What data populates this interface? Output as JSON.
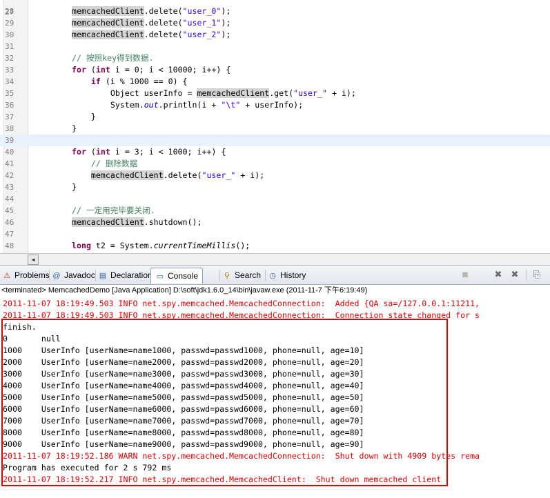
{
  "editor": {
    "lines": [
      {
        "num": "28",
        "text": "memcachedClient.delete(\"user_0\");"
      },
      {
        "num": "29",
        "text": "memcachedClient.delete(\"user_1\");"
      },
      {
        "num": "30",
        "text": "memcachedClient.delete(\"user_2\");"
      },
      {
        "num": "31",
        "text": ""
      },
      {
        "num": "32",
        "text": "// 按照key得到数据."
      },
      {
        "num": "33",
        "text": "for (int i = 0; i < 10000; i++) {"
      },
      {
        "num": "34",
        "text": "    if (i % 1000 == 0) {"
      },
      {
        "num": "35",
        "text": "        Object userInfo = memcachedClient.get(\"user_\" + i);"
      },
      {
        "num": "36",
        "text": "        System.out.println(i + \"\\t\" + userInfo);"
      },
      {
        "num": "37",
        "text": "    }"
      },
      {
        "num": "38",
        "text": "}"
      },
      {
        "num": "39",
        "text": ""
      },
      {
        "num": "40",
        "text": "for (int i = 3; i < 1000; i++) {"
      },
      {
        "num": "41",
        "text": "    // 删除数据"
      },
      {
        "num": "42",
        "text": "    memcachedClient.delete(\"user_\" + i);"
      },
      {
        "num": "43",
        "text": "}"
      },
      {
        "num": "44",
        "text": ""
      },
      {
        "num": "45",
        "text": "// 一定用完毕要关闭."
      },
      {
        "num": "46",
        "text": "memcachedClient.shutdown();"
      },
      {
        "num": "47",
        "text": ""
      },
      {
        "num": "48",
        "text": "long t2 = System.currentTimeMillis();"
      }
    ]
  },
  "tabs": [
    {
      "label": "Problems",
      "icon": "problems-icon",
      "glyph": "⚠",
      "color": "#c03030"
    },
    {
      "label": "Javadoc",
      "icon": "javadoc-icon",
      "glyph": "@",
      "color": "#3a64a8"
    },
    {
      "label": "Declaration",
      "icon": "declaration-icon",
      "glyph": "▤",
      "color": "#3a64a8"
    },
    {
      "label": "Console",
      "icon": "console-icon",
      "glyph": "▭",
      "color": "#3a64a8"
    },
    {
      "label": "Search",
      "icon": "search-icon",
      "glyph": "⚲",
      "color": "#b07a10"
    },
    {
      "label": "History",
      "icon": "history-icon",
      "glyph": "◷",
      "color": "#3a64a8"
    }
  ],
  "toolbar": {
    "stop_glyph": "■",
    "remove_glyph": "✖",
    "remove_all_glyph": "✖",
    "copy_glyph": "⎘"
  },
  "console": {
    "status": "<terminated> MemcachedDemo [Java Application] D:\\soft\\jdk1.6.0_14\\bin\\javaw.exe (2011-11-7 下午6:19:49)",
    "lines": [
      {
        "type": "err",
        "text": "2011-11-07 18:19:49.503 INFO net.spy.memcached.MemcachedConnection:  Added {QA sa=/127.0.0.1:11211,"
      },
      {
        "type": "err",
        "text": "2011-11-07 18:19:49.503 INFO net.spy.memcached.MemcachedConnection:  Connection state changed for s"
      },
      {
        "type": "out",
        "text": "finish."
      },
      {
        "type": "out",
        "text": "0\tnull"
      },
      {
        "type": "out",
        "text": "1000\tUserInfo [userName=name1000, passwd=passwd1000, phone=null, age=10]"
      },
      {
        "type": "out",
        "text": "2000\tUserInfo [userName=name2000, passwd=passwd2000, phone=null, age=20]"
      },
      {
        "type": "out",
        "text": "3000\tUserInfo [userName=name3000, passwd=passwd3000, phone=null, age=30]"
      },
      {
        "type": "out",
        "text": "4000\tUserInfo [userName=name4000, passwd=passwd4000, phone=null, age=40]"
      },
      {
        "type": "out",
        "text": "5000\tUserInfo [userName=name5000, passwd=passwd5000, phone=null, age=50]"
      },
      {
        "type": "out",
        "text": "6000\tUserInfo [userName=name6000, passwd=passwd6000, phone=null, age=60]"
      },
      {
        "type": "out",
        "text": "7000\tUserInfo [userName=name7000, passwd=passwd7000, phone=null, age=70]"
      },
      {
        "type": "out",
        "text": "8000\tUserInfo [userName=name8000, passwd=passwd8000, phone=null, age=80]"
      },
      {
        "type": "out",
        "text": "9000\tUserInfo [userName=name9000, passwd=passwd9000, phone=null, age=90]"
      },
      {
        "type": "err",
        "text": "2011-11-07 18:19:52.186 WARN net.spy.memcached.MemcachedConnection:  Shut down with 4909 bytes rema"
      },
      {
        "type": "out",
        "text": "Program has executed for 2 s 792 ms"
      },
      {
        "type": "err",
        "text": "2011-11-07 18:19:52.217 INFO net.spy.memcached.MemcachedClient:  Shut down memcached client"
      }
    ]
  },
  "colors": {
    "error_text": "#e00000",
    "highlight_box": "#e00000",
    "keyword": "#7f0055",
    "string": "#2a00ff",
    "comment": "#3f7f5f"
  }
}
